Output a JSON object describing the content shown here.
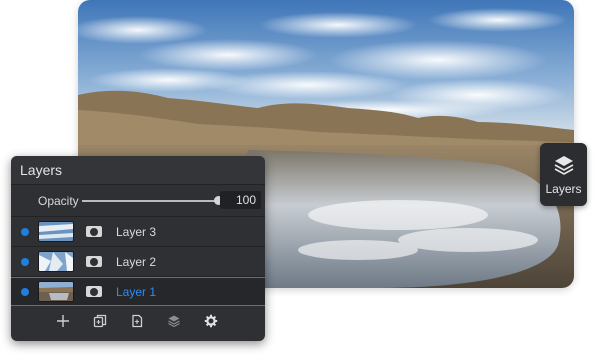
{
  "photo": {
    "subject": "desert lake with mountains and clouds"
  },
  "layers_toggle": {
    "label": "Layers",
    "icon": "layers-stack-icon"
  },
  "panel": {
    "title": "Layers",
    "opacity": {
      "label": "Opacity",
      "value": "100",
      "fraction": 1.0
    },
    "layers": [
      {
        "name": "Layer 3",
        "visible": true,
        "selected": false,
        "thumb": "sky"
      },
      {
        "name": "Layer 2",
        "visible": true,
        "selected": false,
        "thumb": "clouds"
      },
      {
        "name": "Layer 1",
        "visible": true,
        "selected": true,
        "thumb": "landscape"
      }
    ],
    "toolbar": [
      {
        "name": "add-layer",
        "icon": "plus-icon"
      },
      {
        "name": "duplicate-layer",
        "icon": "duplicate-icon"
      },
      {
        "name": "layer-from-file",
        "icon": "document-icon"
      },
      {
        "name": "merge-layers",
        "icon": "layers-icon"
      },
      {
        "name": "layer-settings",
        "icon": "gear-icon"
      }
    ]
  },
  "colors": {
    "accent": "#1e7fe0",
    "panel_bg": "#2e3033"
  }
}
